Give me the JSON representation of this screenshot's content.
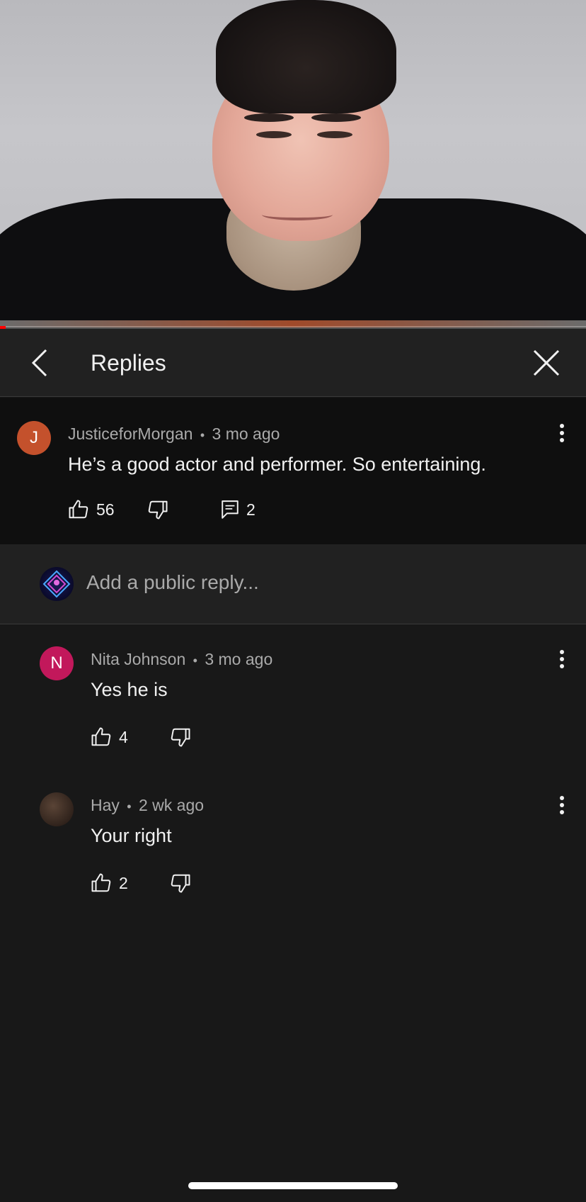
{
  "video": {
    "progress_percent": 1
  },
  "header": {
    "title": "Replies"
  },
  "parent_comment": {
    "avatar_letter": "J",
    "avatar_color": "#c4512c",
    "author": "JusticeforMorgan",
    "separator": "•",
    "time": "3 mo ago",
    "text": "He’s a good actor and performer. So entertaining.",
    "likes": "56",
    "replies_count": "2"
  },
  "reply_input": {
    "placeholder": "Add a public reply..."
  },
  "replies": [
    {
      "avatar_letter": "N",
      "avatar_color": "#c2185b",
      "author": "Nita Johnson",
      "separator": "•",
      "time": "3 mo ago",
      "text": "Yes he is",
      "likes": "4"
    },
    {
      "avatar_letter": "",
      "avatar_color": "#3a2c24",
      "author": "Hay",
      "separator": "•",
      "time": "2 wk ago",
      "text": "Your right",
      "likes": "2"
    }
  ],
  "icons": {
    "back": "chevron-left-icon",
    "close": "close-icon",
    "more": "more-vert-icon",
    "like": "thumb-up-icon",
    "dislike": "thumb-down-icon",
    "reply": "comment-icon"
  }
}
